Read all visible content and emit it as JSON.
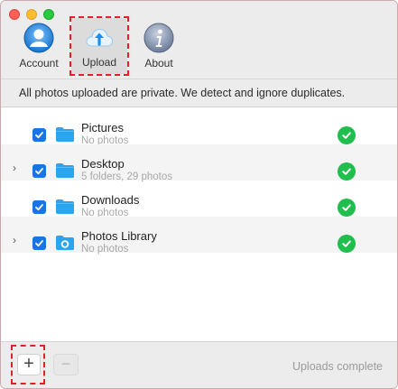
{
  "toolbar": {
    "tabs": [
      {
        "label": "Account",
        "icon": "account-icon"
      },
      {
        "label": "Upload",
        "icon": "cloud-upload-icon",
        "active": true
      },
      {
        "label": "About",
        "icon": "info-icon"
      }
    ]
  },
  "info_text": "All photos uploaded are private. We detect and ignore duplicates.",
  "folders": [
    {
      "title": "Pictures",
      "subtitle": "No photos",
      "checked": true,
      "expandable": false,
      "icon": "folder-icon",
      "status": "complete"
    },
    {
      "title": "Desktop",
      "subtitle": "5 folders, 29 photos",
      "checked": true,
      "expandable": true,
      "icon": "folder-icon",
      "status": "complete"
    },
    {
      "title": "Downloads",
      "subtitle": "No photos",
      "checked": true,
      "expandable": false,
      "icon": "folder-icon",
      "status": "complete"
    },
    {
      "title": "Photos Library",
      "subtitle": "No photos",
      "checked": true,
      "expandable": true,
      "icon": "photos-library-icon",
      "status": "complete"
    }
  ],
  "footer": {
    "add_label": "+",
    "remove_label": "−",
    "status": "Uploads complete"
  },
  "colors": {
    "accent": "#1a73e8",
    "success": "#1fbe4e",
    "highlight": "#e0202a"
  }
}
